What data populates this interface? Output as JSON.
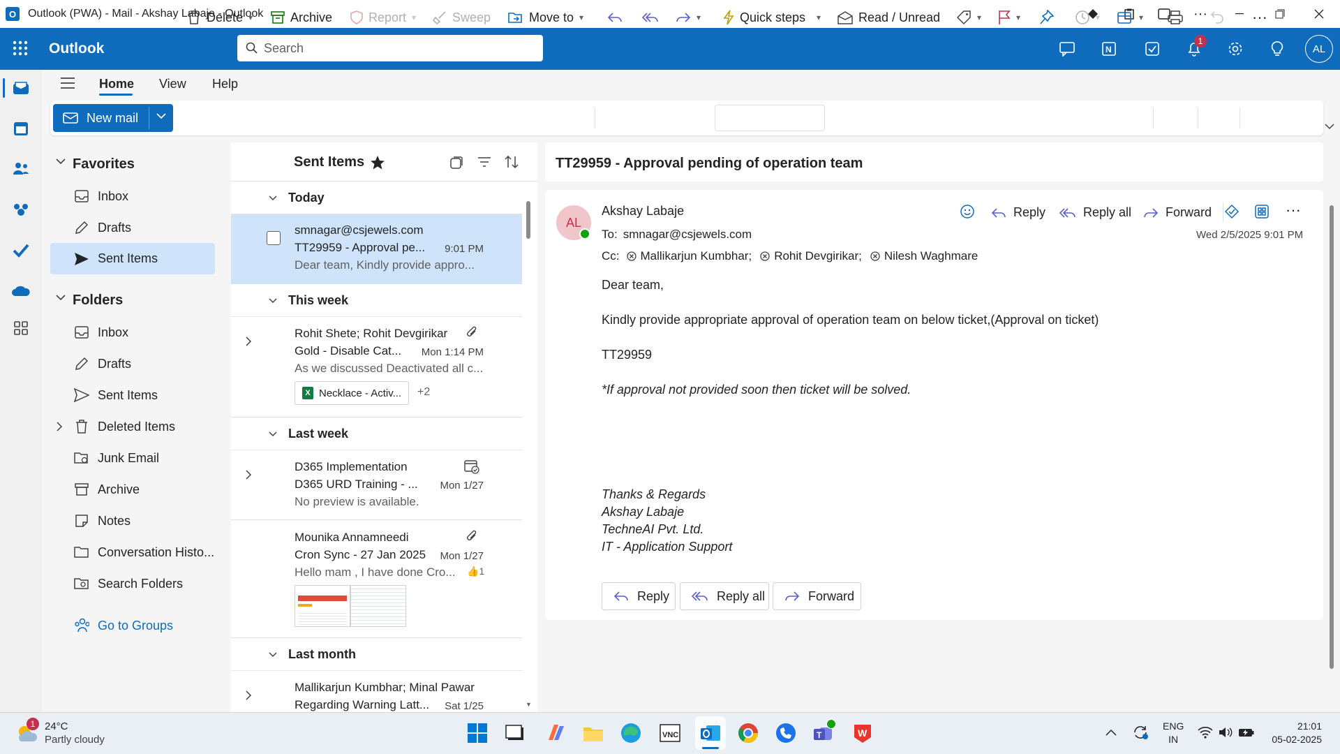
{
  "window": {
    "title": "Outlook (PWA) - Mail - Akshay Labaje - Outlook"
  },
  "header": {
    "app_name": "Outlook",
    "search_placeholder": "Search",
    "notification_count": "1",
    "avatar_initials": "AL"
  },
  "tabs": [
    "Home",
    "View",
    "Help"
  ],
  "ribbon": {
    "new_mail": "New mail",
    "delete": "Delete",
    "archive": "Archive",
    "report": "Report",
    "sweep": "Sweep",
    "move_to": "Move to",
    "quick_steps": "Quick steps",
    "read_unread": "Read / Unread"
  },
  "folders": {
    "favorites_header": "Favorites",
    "favorites": [
      "Inbox",
      "Drafts",
      "Sent Items"
    ],
    "folders_header": "Folders",
    "items": [
      "Inbox",
      "Drafts",
      "Sent Items",
      "Deleted Items",
      "Junk Email",
      "Archive",
      "Notes",
      "Conversation Histo...",
      "Search Folders"
    ],
    "go_to_groups": "Go to Groups"
  },
  "list": {
    "title": "Sent Items",
    "groups": [
      "Today",
      "This week",
      "Last week",
      "Last month"
    ],
    "messages": [
      {
        "from": "smnagar@csjewels.com",
        "subject": "TT29959 - Approval pe...",
        "time": "9:01 PM",
        "preview": "Dear team, Kindly provide appro..."
      },
      {
        "from": "Rohit Shete; Rohit Devgirikar",
        "subject": "Gold - Disable Cat...",
        "time": "Mon 1:14 PM",
        "preview": "As we discussed Deactivated all c...",
        "attachment": "Necklace - Activ...",
        "more": "+2"
      },
      {
        "from": "D365 Implementation",
        "subject": "D365 URD Training - ...",
        "time": "Mon 1/27",
        "preview": "No preview is available."
      },
      {
        "from": "Mounika Annamneedi",
        "subject": "Cron Sync - 27 Jan 2025",
        "time": "Mon 1/27",
        "preview": "Hello mam , I have done Cro...",
        "reaction": "👍1"
      },
      {
        "from": "Mallikarjun Kumbhar; Minal Pawar",
        "subject": "Regarding Warning Latt...",
        "time": "Sat 1/25"
      }
    ]
  },
  "reading": {
    "subject": "TT29959 - Approval pending of operation team",
    "sender": "Akshay Labaje",
    "sender_initials": "AL",
    "to_label": "To:",
    "to": "smnagar@csjewels.com",
    "cc_label": "Cc:",
    "cc": [
      "Mallikarjun Kumbhar;",
      "Rohit Devgirikar;",
      "Nilesh Waghmare"
    ],
    "date": "Wed 2/5/2025 9:01 PM",
    "reply": "Reply",
    "reply_all": "Reply all",
    "forward": "Forward",
    "body": [
      "Dear team,",
      "Kindly provide appropriate approval of operation team on below ticket,(Approval on ticket)",
      "TT29959",
      "*If approval not provided soon then ticket will be solved."
    ],
    "signature": [
      "Thanks & Regards",
      "Akshay Labaje",
      "TechneAI Pvt. Ltd.",
      "IT - Application Support"
    ]
  },
  "taskbar": {
    "weather_temp": "24°C",
    "weather_desc": "Partly cloudy",
    "weather_badge": "1",
    "lang1": "ENG",
    "lang2": "IN",
    "time": "21:01",
    "date": "05-02-2025"
  },
  "colors": {
    "brand": "#0f6cbd",
    "selected": "#cfe4fa",
    "avatar_bg": "#f1c6cb",
    "avatar_fg": "#c4314b",
    "presence": "#13a10e"
  }
}
